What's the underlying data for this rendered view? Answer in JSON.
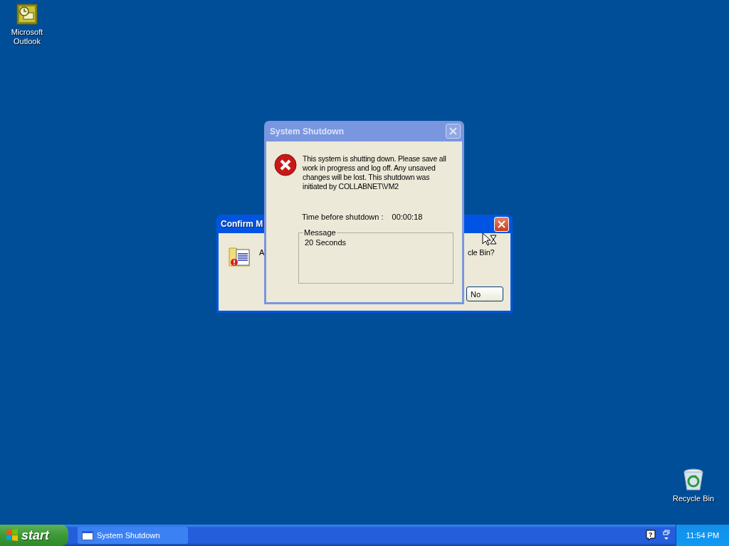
{
  "desktop_icons": [
    {
      "label": "Microsoft Outlook",
      "kind": "outlook"
    },
    {
      "label": "Recycle Bin",
      "kind": "recycle"
    }
  ],
  "confirm_window": {
    "title": "Confirm M",
    "message_start": "A",
    "message_end": "cle Bin?",
    "button": "No"
  },
  "shutdown_dialog": {
    "title": "System Shutdown",
    "message": "This system is shutting down. Please save all work in progress and log off. Any unsaved changes will be lost. This shutdown was initiated by COLLABNET\\VM2",
    "time_label": "Time before shutdown :",
    "time_value": "00:00:18",
    "group_label": "Message",
    "group_text": "20 Seconds"
  },
  "taskbar": {
    "start": "start",
    "tasks": [
      {
        "label": "System Shutdown",
        "selected": false
      }
    ],
    "help_glyph": "?",
    "clock": "11:54 PM"
  }
}
